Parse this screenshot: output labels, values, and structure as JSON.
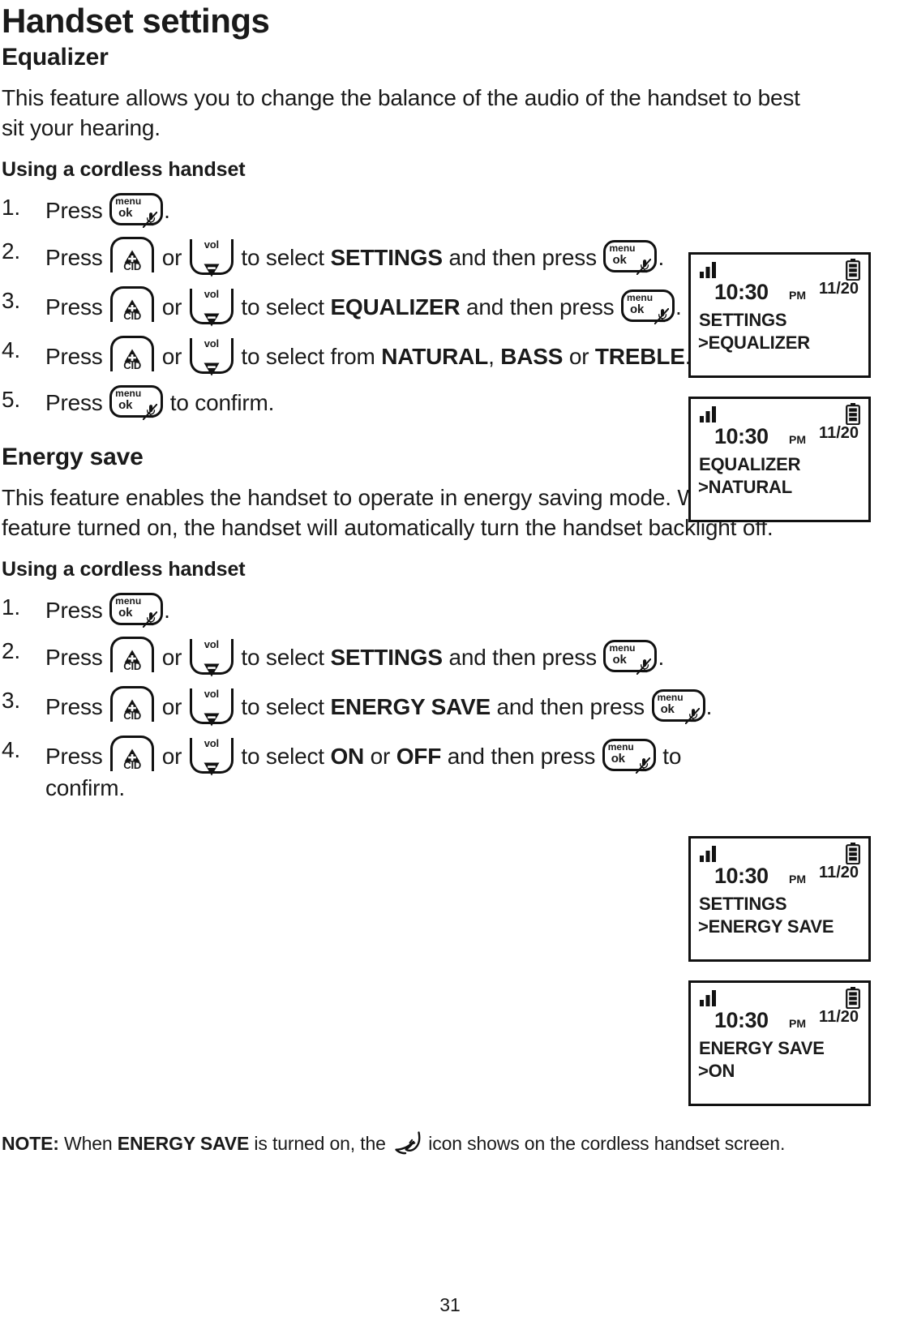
{
  "document": {
    "page_title": "Handset settings",
    "page_number": "31"
  },
  "sections": [
    {
      "id": "equalizer",
      "title": "Equalizer",
      "intro": "This feature allows you to change the balance of the audio of the handset to best sit your hearing.",
      "subheading": "Using a cordless handset",
      "steps": [
        {
          "num": "1.",
          "parts": [
            {
              "t": "text",
              "v": "Press "
            },
            {
              "t": "key",
              "v": "menu-ok"
            },
            {
              "t": "text",
              "v": "."
            }
          ]
        },
        {
          "num": "2.",
          "parts": [
            {
              "t": "text",
              "v": "Press "
            },
            {
              "t": "key",
              "v": "cid-up"
            },
            {
              "t": "text",
              "v": " or "
            },
            {
              "t": "key",
              "v": "vol-down"
            },
            {
              "t": "text",
              "v": " to select "
            },
            {
              "t": "bold",
              "v": "SETTINGS"
            },
            {
              "t": "text",
              "v": " and then press "
            },
            {
              "t": "key",
              "v": "menu-ok"
            },
            {
              "t": "text",
              "v": "."
            }
          ]
        },
        {
          "num": "3.",
          "parts": [
            {
              "t": "text",
              "v": "Press "
            },
            {
              "t": "key",
              "v": "cid-up"
            },
            {
              "t": "text",
              "v": " or "
            },
            {
              "t": "key",
              "v": "vol-down"
            },
            {
              "t": "text",
              "v": " to select "
            },
            {
              "t": "bold",
              "v": "EQUALIZER"
            },
            {
              "t": "text",
              "v": " and then press "
            },
            {
              "t": "key",
              "v": "menu-ok"
            },
            {
              "t": "text",
              "v": "."
            }
          ]
        },
        {
          "num": "4.",
          "parts": [
            {
              "t": "text",
              "v": "Press "
            },
            {
              "t": "key",
              "v": "cid-up"
            },
            {
              "t": "text",
              "v": " or "
            },
            {
              "t": "key",
              "v": "vol-down"
            },
            {
              "t": "text",
              "v": " to select from "
            },
            {
              "t": "bold",
              "v": "NATURAL"
            },
            {
              "t": "text",
              "v": ", "
            },
            {
              "t": "bold",
              "v": "BASS"
            },
            {
              "t": "text",
              "v": " or "
            },
            {
              "t": "bold",
              "v": "TREBLE"
            },
            {
              "t": "text",
              "v": "."
            }
          ]
        },
        {
          "num": "5.",
          "parts": [
            {
              "t": "text",
              "v": "Press "
            },
            {
              "t": "key",
              "v": "menu-ok"
            },
            {
              "t": "text",
              "v": " to confirm."
            }
          ]
        }
      ]
    },
    {
      "id": "energy-save",
      "title": "Energy save",
      "intro": "This feature enables the handset to operate in energy saving mode. With this feature turned on, the handset will automatically turn the handset backlight off.",
      "subheading": "Using a cordless handset",
      "steps": [
        {
          "num": "1.",
          "parts": [
            {
              "t": "text",
              "v": "Press "
            },
            {
              "t": "key",
              "v": "menu-ok"
            },
            {
              "t": "text",
              "v": "."
            }
          ]
        },
        {
          "num": "2.",
          "parts": [
            {
              "t": "text",
              "v": "Press "
            },
            {
              "t": "key",
              "v": "cid-up"
            },
            {
              "t": "text",
              "v": " or "
            },
            {
              "t": "key",
              "v": "vol-down"
            },
            {
              "t": "text",
              "v": " to select "
            },
            {
              "t": "bold",
              "v": "SETTINGS"
            },
            {
              "t": "text",
              "v": " and then press "
            },
            {
              "t": "key",
              "v": "menu-ok"
            },
            {
              "t": "text",
              "v": "."
            }
          ]
        },
        {
          "num": "3.",
          "parts": [
            {
              "t": "text",
              "v": "Press "
            },
            {
              "t": "key",
              "v": "cid-up"
            },
            {
              "t": "text",
              "v": " or "
            },
            {
              "t": "key",
              "v": "vol-down"
            },
            {
              "t": "text",
              "v": " to select "
            },
            {
              "t": "bold",
              "v": "ENERGY SAVE"
            },
            {
              "t": "text",
              "v": " and then press "
            },
            {
              "t": "key",
              "v": "menu-ok"
            },
            {
              "t": "text",
              "v": "."
            }
          ]
        },
        {
          "num": "4.",
          "parts": [
            {
              "t": "text",
              "v": "Press "
            },
            {
              "t": "key",
              "v": "cid-up"
            },
            {
              "t": "text",
              "v": " or "
            },
            {
              "t": "key",
              "v": "vol-down"
            },
            {
              "t": "text",
              "v": " to select "
            },
            {
              "t": "bold",
              "v": "ON"
            },
            {
              "t": "text",
              "v": " or "
            },
            {
              "t": "bold",
              "v": "OFF"
            },
            {
              "t": "text",
              "v": " and then press "
            },
            {
              "t": "key",
              "v": "menu-ok"
            },
            {
              "t": "text",
              "v": " to confirm."
            }
          ]
        }
      ]
    }
  ],
  "note": {
    "label": "NOTE:",
    "before_bold": " When ",
    "bold": "ENERGY SAVE",
    "after_bold": " is turned on, the ",
    "icon": "leaf-icon",
    "tail": " icon shows on the cordless handset screen."
  },
  "keys": {
    "menu_ok": {
      "name": "menu-ok-key",
      "top_label": "menu",
      "bottom_label": "ok",
      "icon": "mute-mic-icon"
    },
    "cid_up": {
      "name": "cid-up-key",
      "label": "CID",
      "icon": "up-triangle-icon"
    },
    "vol_down": {
      "name": "vol-down-key",
      "label": "vol",
      "icon": "down-triangle-icon"
    }
  },
  "screens": [
    {
      "id": "screen-settings-equalizer",
      "signal": "signal-bars-icon",
      "battery": "battery-icon",
      "time": "10:30",
      "ampm": "PM",
      "date": "11/20",
      "line1": "SETTINGS",
      "line2": ">EQUALIZER"
    },
    {
      "id": "screen-equalizer-natural",
      "signal": "signal-bars-icon",
      "battery": "battery-icon",
      "time": "10:30",
      "ampm": "PM",
      "date": "11/20",
      "line1": "EQUALIZER",
      "line2": ">NATURAL"
    },
    {
      "id": "screen-settings-energysave",
      "signal": "signal-bars-icon",
      "battery": "battery-icon",
      "time": "10:30",
      "ampm": "PM",
      "date": "11/20",
      "line1": "SETTINGS",
      "line2": ">ENERGY SAVE"
    },
    {
      "id": "screen-energysave-on",
      "signal": "signal-bars-icon",
      "battery": "battery-icon",
      "time": "10:30",
      "ampm": "PM",
      "date": "11/20",
      "line1": "ENERGY SAVE",
      "line2": ">ON"
    }
  ],
  "colors": {
    "ink": "#1a1a1a",
    "paper": "#ffffff"
  }
}
